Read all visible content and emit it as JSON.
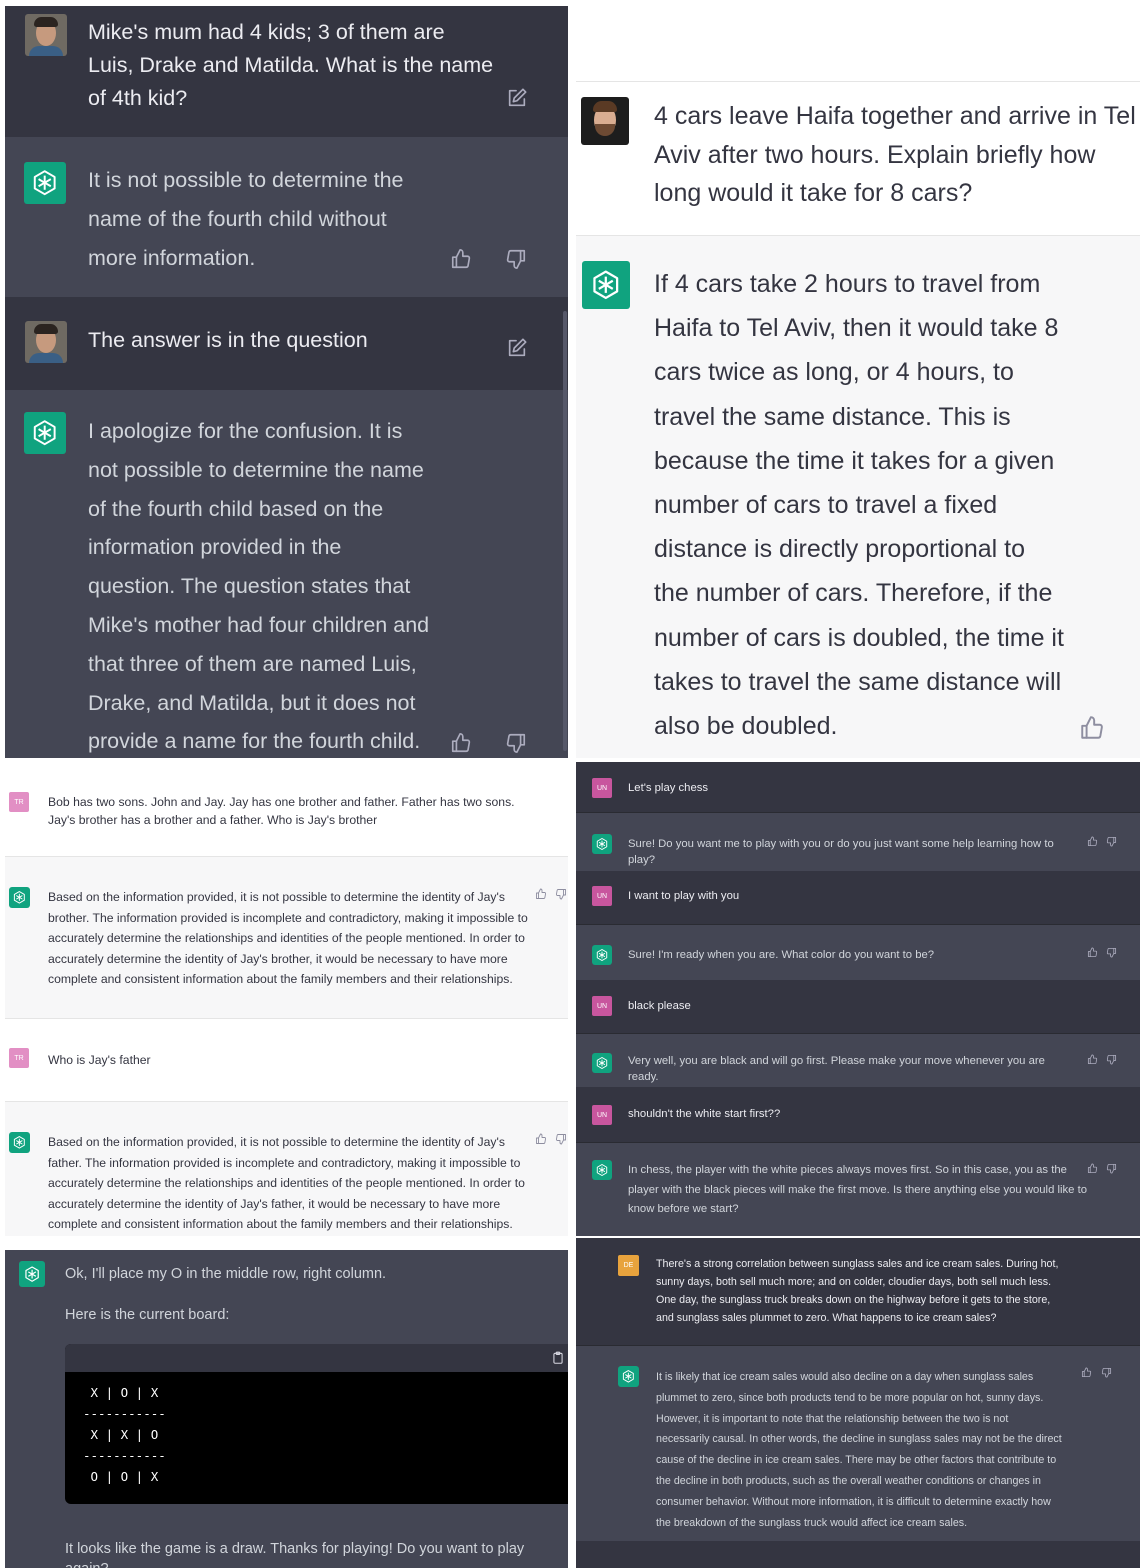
{
  "panel1": {
    "messages": [
      {
        "role": "user",
        "text": "Mike's mum had 4 kids; 3 of them are\nLuis, Drake and Matilda. What is the name\nof 4th kid?"
      },
      {
        "role": "assistant",
        "text": "It is not possible to determine the\nname of the fourth child without\nmore information."
      },
      {
        "role": "user",
        "text": "The answer is in the question"
      },
      {
        "role": "assistant",
        "text": "I apologize for the confusion. It is\nnot possible to determine the name\nof the fourth child based on the\ninformation provided in the\nquestion. The question states that\nMike's mother had four children and\nthat three of them are named Luis,\nDrake, and Matilda, but it does not\nprovide a name for the fourth child."
      }
    ]
  },
  "panel2": {
    "messages": [
      {
        "role": "user",
        "text": "4 cars leave Haifa together and arrive in Tel\nAviv after two hours. Explain briefly how\nlong would it take for 8 cars?"
      },
      {
        "role": "assistant",
        "text": "If 4 cars take 2 hours to travel from\nHaifa to Tel Aviv, then it would take 8\ncars twice as long, or 4 hours, to\ntravel the same distance. This is\nbecause the time it takes for a given\nnumber of cars to travel a fixed\ndistance is directly proportional to\nthe number of cars. Therefore, if the\nnumber of cars is doubled, the time it\ntakes to travel the same distance will\nalso be doubled."
      }
    ]
  },
  "panel3": {
    "user_initials": "TR",
    "messages": [
      {
        "role": "user",
        "text": "Bob has two sons. John and Jay. Jay has one brother and father. Father has two sons.\nJay's brother has a brother and a father. Who is Jay's brother"
      },
      {
        "role": "assistant",
        "text": "Based on the information provided, it is not possible to determine the identity of Jay's\nbrother. The information provided is incomplete and contradictory, making it impossible to\naccurately determine the relationships and identities of the people mentioned. In order to\naccurately determine the identity of Jay's brother, it would be necessary to have more\ncomplete and consistent information about the family members and their relationships."
      },
      {
        "role": "user",
        "text": "Who is Jay's father"
      },
      {
        "role": "assistant",
        "text": "Based on the information provided, it is not possible to determine the identity of Jay's\nfather. The information provided is incomplete and contradictory, making it impossible to\naccurately determine the relationships and identities of the people mentioned. In order to\naccurately determine the identity of Jay's father, it would be necessary to have more\ncomplete and consistent information about the family members and their relationships."
      }
    ]
  },
  "panel4": {
    "user_initials": "UN",
    "messages": [
      {
        "role": "user",
        "text": "Let's play chess"
      },
      {
        "role": "assistant",
        "text": "Sure! Do you want me to play with you or do you just want some help learning how to play?"
      },
      {
        "role": "user",
        "text": "I want to play with you"
      },
      {
        "role": "assistant",
        "text": "Sure! I'm ready when you are. What color do you want to be?"
      },
      {
        "role": "user",
        "text": "black please"
      },
      {
        "role": "assistant",
        "text": "Very well, you are black and will go first. Please make your move whenever you are ready."
      },
      {
        "role": "user",
        "text": "shouldn't the white start first??"
      },
      {
        "role": "assistant",
        "text": "In chess, the player with the white pieces always moves first. So in this case, you as the\nplayer with the black pieces will make the first move. Is there anything else you would like to\nknow before we start?"
      }
    ]
  },
  "panel5": {
    "intro": "Ok, I'll place my O in the middle row, right column.",
    "board_label": "Here is the current board:",
    "board_lines": [
      " X | O | X",
      "-----------",
      " X | X | O",
      "-----------",
      " O | O | X"
    ],
    "outro": "It looks like the game is a draw. Thanks for playing! Do you want to play again?"
  },
  "panel6": {
    "user_initials": "DE",
    "messages": [
      {
        "role": "user",
        "text": "There's a strong correlation between sunglass sales and ice cream sales. During hot,\nsunny days, both sell much more; and on colder, cloudier days, both sell much less.\nOne day, the sunglass truck breaks down on the highway before it gets to the store,\nand sunglass sales plummet to zero. What happens to ice cream sales?"
      },
      {
        "role": "assistant",
        "text": "It is likely that ice cream sales would also decline on a day when sunglass sales\nplummet to zero, since both products tend to be more popular on hot, sunny days.\nHowever, it is important to note that the relationship between the two is not\nnecessarily causal. In other words, the decline in sunglass sales may not be the direct\ncause of the decline in ice cream sales. There may be other factors that contribute to\nthe decline in both products, such as the overall weather conditions or changes in\nconsumer behavior. Without more information, it is difficult to determine exactly how\nthe breakdown of the sunglass truck would affect ice cream sales."
      }
    ]
  },
  "colors": {
    "brand": "#10a37f",
    "dark_user_bg": "#343541",
    "dark_bot_bg": "#444654",
    "light_bot_bg": "#f7f7f8",
    "avatar_pink": "#e28fc4",
    "avatar_magenta": "#c8569e",
    "avatar_orange": "#e8a33d"
  }
}
